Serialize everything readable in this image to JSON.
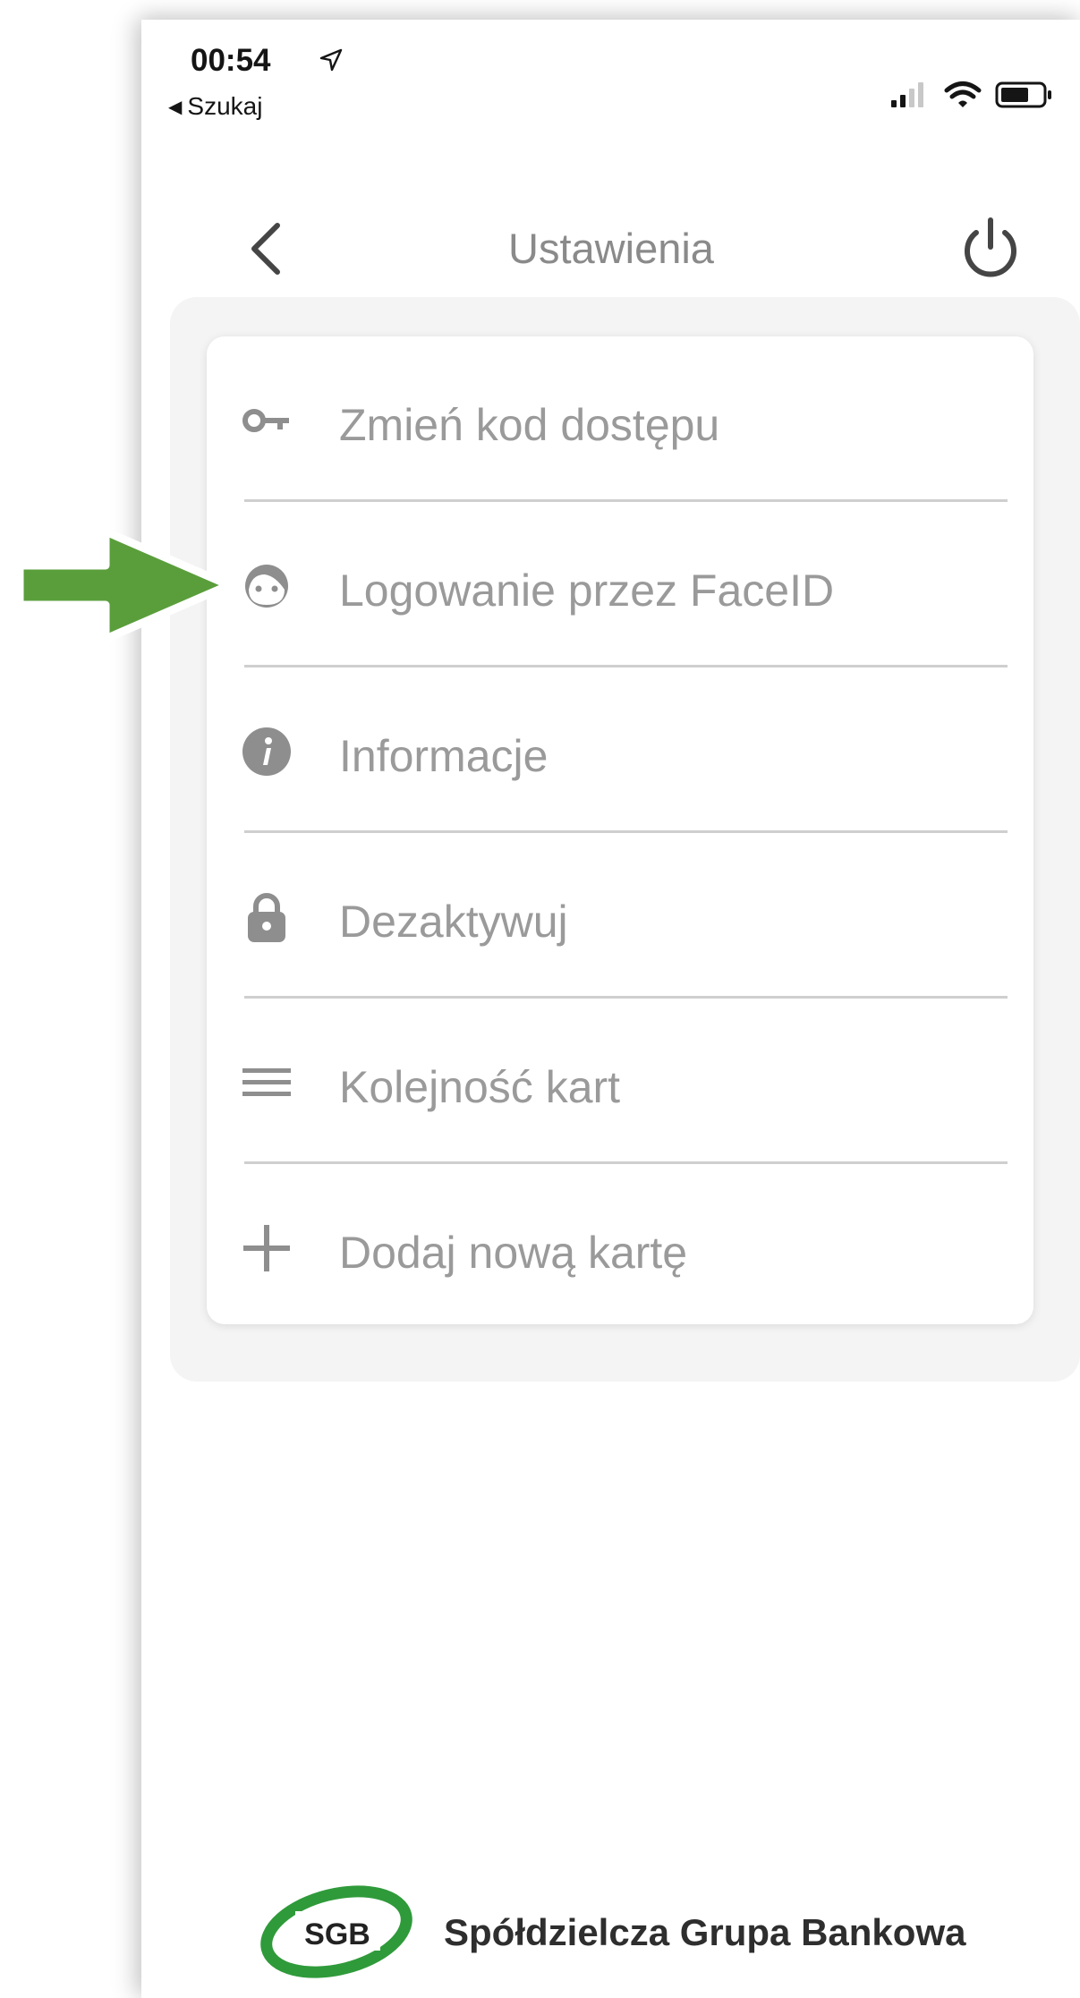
{
  "status_bar": {
    "time": "00:54",
    "back_app": "Szukaj",
    "back_app_icon": "back-triangle-icon",
    "location_icon": "location-arrow-icon",
    "signal_icon": "cellular-signal-icon",
    "wifi_icon": "wifi-icon",
    "battery_icon": "battery-icon"
  },
  "header": {
    "title": "Ustawienia",
    "back_icon": "chevron-left-icon",
    "power_icon": "power-icon"
  },
  "menu": {
    "items": [
      {
        "label": "Zmień kod dostępu",
        "icon": "key-icon"
      },
      {
        "label": "Logowanie przez FaceID",
        "icon": "face-icon"
      },
      {
        "label": "Informacje",
        "icon": "info-icon"
      },
      {
        "label": "Dezaktywuj",
        "icon": "lock-icon"
      },
      {
        "label": "Kolejność kart",
        "icon": "reorder-icon"
      },
      {
        "label": "Dodaj nową kartę",
        "icon": "plus-icon"
      }
    ]
  },
  "footer": {
    "logo_text": "SGB",
    "brand_name": "Spółdzielcza Grupa Bankowa"
  },
  "annotation": {
    "arrow_icon": "green-arrow-icon",
    "arrow_color": "#5a9e3c",
    "points_to_item": "Logowanie przez FaceID"
  },
  "colors": {
    "text_muted": "#9a9a9a",
    "title": "#8a8a8a",
    "icon": "#8e8e8e",
    "divider": "#cfcfcf",
    "brand_green": "#2f9a3a"
  }
}
